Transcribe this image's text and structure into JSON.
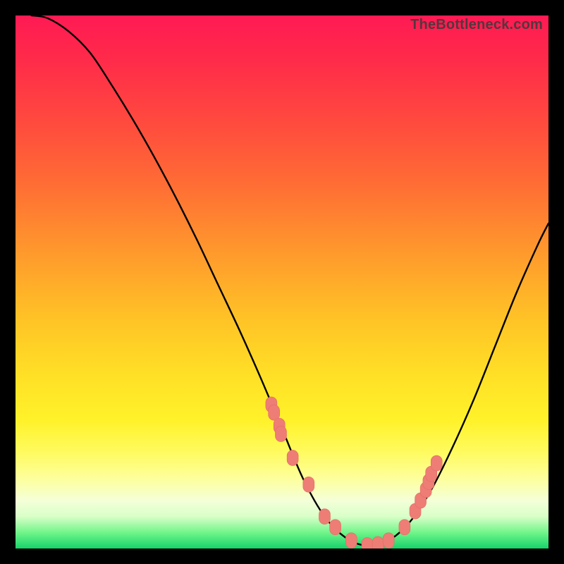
{
  "watermark": "TheBottleneck.com",
  "colors": {
    "curve_stroke": "#000000",
    "marker_fill": "#ee7d76",
    "marker_stroke": "#e46a63"
  },
  "chart_data": {
    "type": "line",
    "title": "",
    "xlabel": "",
    "ylabel": "",
    "xlim": [
      0,
      100
    ],
    "ylim": [
      0,
      100
    ],
    "series": [
      {
        "name": "bottleneck-curve",
        "x": [
          3,
          6,
          10,
          14,
          18,
          22,
          26,
          30,
          34,
          38,
          42,
          46,
          50,
          54,
          58,
          62,
          66,
          70,
          74,
          78,
          82,
          86,
          90,
          94,
          98,
          100
        ],
        "y": [
          100,
          99.5,
          97,
          93,
          87,
          80.5,
          73.5,
          66,
          58,
          49.5,
          41,
          32,
          22.5,
          13,
          6,
          2,
          0.5,
          1.5,
          5,
          11,
          19,
          28,
          38,
          48,
          57,
          61
        ]
      }
    ],
    "markers": {
      "name": "highlighted-points",
      "x": [
        48,
        48.5,
        49.5,
        49.8,
        52,
        55,
        58,
        60,
        63,
        66,
        68,
        70,
        73,
        75,
        76,
        77,
        77.5,
        78,
        79
      ],
      "y": [
        27,
        25.5,
        23,
        21.5,
        17,
        12,
        6,
        4,
        1.5,
        0.6,
        0.8,
        1.5,
        4,
        7,
        9,
        11,
        12.5,
        14,
        16
      ]
    }
  }
}
